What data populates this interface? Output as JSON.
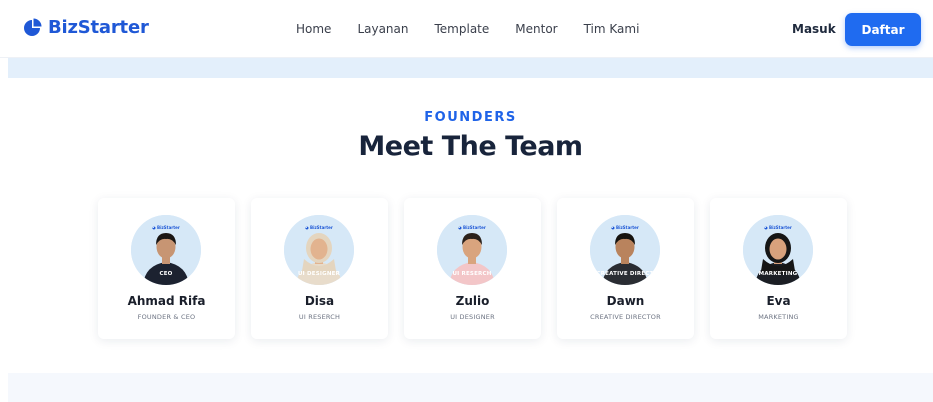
{
  "brand": {
    "name": "BizStarter",
    "icon": "pie-logo-icon",
    "color": "#1f58d6"
  },
  "nav": {
    "links": [
      "Home",
      "Layanan",
      "Template",
      "Mentor",
      "Tim Kami"
    ],
    "login_label": "Masuk",
    "signup_label": "Daftar",
    "accent": "#1f6bf0"
  },
  "section": {
    "eyebrow": "FOUNDERS",
    "title": "Meet The Team"
  },
  "team": [
    {
      "name": "Ahmad Rifa",
      "role": "FOUNDER & CEO",
      "badge": "CEO",
      "photo_logo": "BizStarter",
      "shirt": "#1c2230",
      "hair": "#1a1614",
      "skin": "#c79573",
      "hijab": false
    },
    {
      "name": "Disa",
      "role": "UI RESERCH",
      "badge": "UI DESIGNER",
      "photo_logo": "BizStarter",
      "shirt": "#e8dccb",
      "hair": "#e4d5bf",
      "skin": "#e2b38f",
      "hijab": true
    },
    {
      "name": "Zulio",
      "role": "UI DESIGNER",
      "badge": "UI RESERCH",
      "photo_logo": "BizStarter",
      "shirt": "#f3c6c8",
      "hair": "#2b211b",
      "skin": "#d9a47e",
      "hijab": false
    },
    {
      "name": "Dawn",
      "role": "CREATIVE DIRECTOR",
      "badge": "CREATIVE DIRECT",
      "photo_logo": "BizStarter",
      "shirt": "#2a2d33",
      "hair": "#16130f",
      "skin": "#b9835d",
      "hijab": false
    },
    {
      "name": "Eva",
      "role": "MARKETING",
      "badge": "MARKETING",
      "photo_logo": "BizStarter",
      "shirt": "#1b1e24",
      "hair": "#161616",
      "skin": "#d8a17c",
      "hijab": true
    }
  ]
}
